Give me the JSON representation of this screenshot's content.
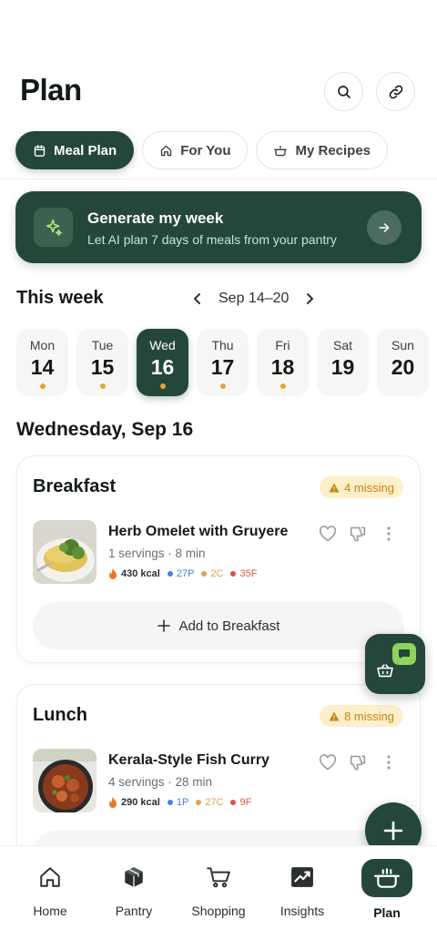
{
  "header": {
    "title": "Plan"
  },
  "tabs": [
    {
      "label": "Meal Plan",
      "icon": "calendar-icon",
      "active": true
    },
    {
      "label": "For You",
      "icon": "home-icon",
      "active": false
    },
    {
      "label": "My Recipes",
      "icon": "pot-icon",
      "active": false
    }
  ],
  "generate": {
    "title": "Generate my week",
    "subtitle": "Let AI plan 7 days of meals from your pantry"
  },
  "week": {
    "title": "This week",
    "range": "Sep 14–20",
    "days": [
      {
        "name": "Mon",
        "num": "14"
      },
      {
        "name": "Tue",
        "num": "15"
      },
      {
        "name": "Wed",
        "num": "16",
        "active": true
      },
      {
        "name": "Thu",
        "num": "17"
      },
      {
        "name": "Fri",
        "num": "18"
      },
      {
        "name": "Sat",
        "num": "19"
      },
      {
        "name": "Sun",
        "num": "20"
      }
    ]
  },
  "selected_date": "Wednesday, Sep 16",
  "meals": {
    "breakfast": {
      "title": "Breakfast",
      "missing": "4 missing",
      "recipe": {
        "name": "Herb Omelet with Gruyere",
        "meta": "1 servings · 8 min",
        "kcal": "430 kcal",
        "protein": "27P",
        "carbs": "2C",
        "fat": "35F"
      },
      "add_label": "Add to Breakfast"
    },
    "lunch": {
      "title": "Lunch",
      "missing": "8 missing",
      "recipe": {
        "name": "Kerala-Style Fish Curry",
        "meta": "4 servings · 28 min",
        "kcal": "290 kcal",
        "protein": "1P",
        "carbs": "27C",
        "fat": "9F"
      }
    }
  },
  "bottom_nav": [
    {
      "label": "Home",
      "icon": "home-icon"
    },
    {
      "label": "Pantry",
      "icon": "box-icon"
    },
    {
      "label": "Shopping",
      "icon": "cart-icon"
    },
    {
      "label": "Insights",
      "icon": "chart-icon"
    },
    {
      "label": "Plan",
      "icon": "pot-icon",
      "active": true
    }
  ],
  "colors": {
    "brand": "#25473a",
    "accent_dot": "#e5a23b",
    "missing_bg": "#fcefc9",
    "missing_text": "#c98412"
  }
}
